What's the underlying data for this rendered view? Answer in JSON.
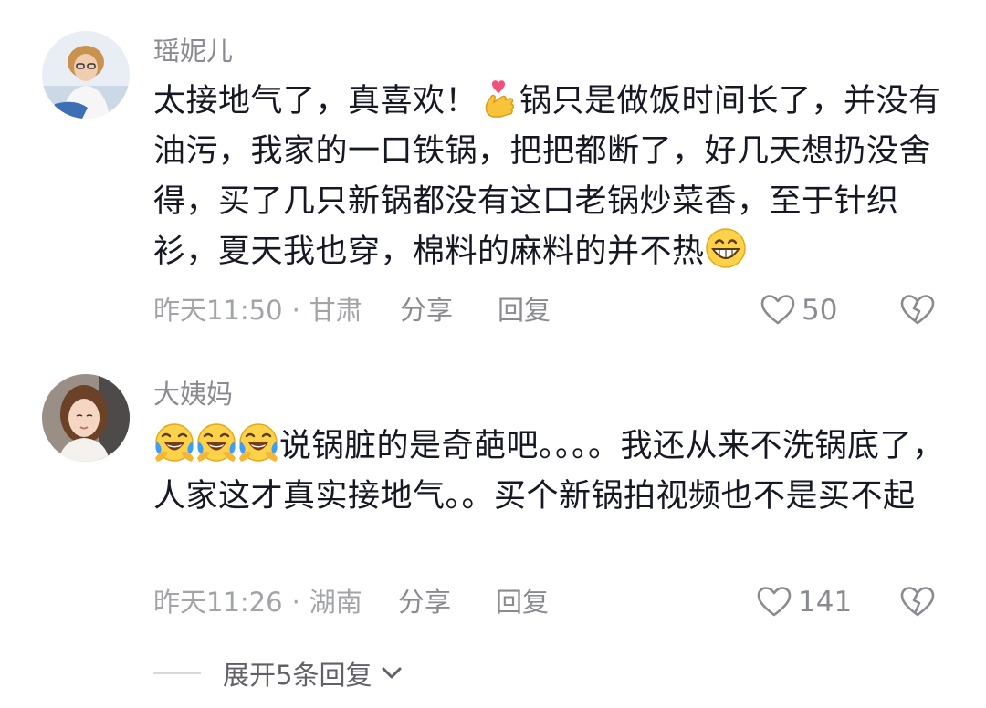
{
  "comments": [
    {
      "username": "瑶妮儿",
      "text_1": "太接地气了，真喜欢！",
      "emoji_1": "finger-heart-emoji",
      "text_2": "锅只是做饭时间长了，并没有油污，我家的一口铁锅，把把都断了，好几天想扔没舍得，买了几只新锅都没有这口老锅炒菜香，至于针织衫，夏天我也穿，棉料的麻料的并不热",
      "emoji_2": "grinning-emoji",
      "time": "昨天11:50",
      "location": "甘肃",
      "separator": "·",
      "share_label": "分享",
      "reply_label": "回复",
      "likes": "50"
    },
    {
      "username": "大姨妈",
      "emoji_1": "laughing-tears-emoji",
      "text": "说锅脏的是奇葩吧。。。。我还从来不洗锅底了，人家这才真实接地气。。买个新锅拍视频也不是买不起",
      "time": "昨天11:26",
      "location": "湖南",
      "separator": "·",
      "share_label": "分享",
      "reply_label": "回复",
      "likes": "141"
    }
  ],
  "expand_replies_label": "展开5条回复",
  "colors": {
    "text": "#161823",
    "secondary": "#8a8b91",
    "meta": "#a3a4a8"
  }
}
